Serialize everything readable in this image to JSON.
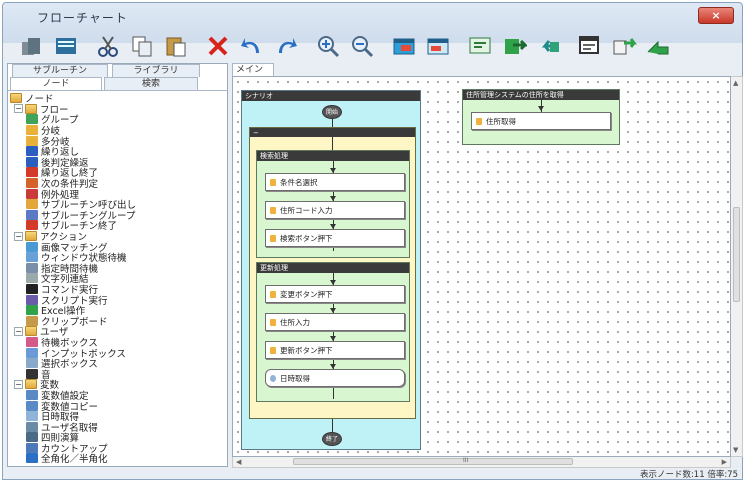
{
  "window": {
    "title": "フローチャート",
    "close_label": "×"
  },
  "toolbar": {
    "buttons": [
      "new-icon",
      "open-icon",
      "cut-icon",
      "copy-icon",
      "paste-icon",
      "delete-icon",
      "undo-icon",
      "redo-icon",
      "zoom-in-icon",
      "zoom-out-icon",
      "insert-icon",
      "insert-alt-icon",
      "edit-icon",
      "import-icon",
      "export-icon",
      "property-icon",
      "replace-icon",
      "run-icon"
    ]
  },
  "left_panel": {
    "tabs_top": [
      "サブルーチン",
      "ライブラリ"
    ],
    "tabs_bottom": [
      "ノード",
      "検索"
    ],
    "tree": [
      {
        "label": "ノード",
        "depth": 0,
        "expander": "",
        "icon": "folder"
      },
      {
        "label": "フロー",
        "depth": 1,
        "expander": "−",
        "icon": "folder"
      },
      {
        "label": "グループ",
        "depth": 2,
        "expander": "",
        "icon": "group"
      },
      {
        "label": "分岐",
        "depth": 2,
        "expander": "",
        "icon": "branch"
      },
      {
        "label": "多分岐",
        "depth": 2,
        "expander": "",
        "icon": "multi-branch"
      },
      {
        "label": "繰り返し",
        "depth": 2,
        "expander": "",
        "icon": "loop"
      },
      {
        "label": "後判定繰返",
        "depth": 2,
        "expander": "",
        "icon": "loop-post"
      },
      {
        "label": "繰り返し終了",
        "depth": 2,
        "expander": "",
        "icon": "loop-end"
      },
      {
        "label": "次の条件判定",
        "depth": 2,
        "expander": "",
        "icon": "next-condition"
      },
      {
        "label": "例外処理",
        "depth": 2,
        "expander": "",
        "icon": "exception"
      },
      {
        "label": "サブルーチン呼び出し",
        "depth": 2,
        "expander": "",
        "icon": "subroutine-call"
      },
      {
        "label": "サブルーチングループ",
        "depth": 2,
        "expander": "",
        "icon": "subroutine-group"
      },
      {
        "label": "サブルーチン終了",
        "depth": 2,
        "expander": "",
        "icon": "subroutine-end"
      },
      {
        "label": "アクション",
        "depth": 1,
        "expander": "−",
        "icon": "folder"
      },
      {
        "label": "画像マッチング",
        "depth": 2,
        "expander": "",
        "icon": "image-match"
      },
      {
        "label": "ウィンドウ状態待機",
        "depth": 2,
        "expander": "",
        "icon": "window-wait"
      },
      {
        "label": "指定時間待機",
        "depth": 2,
        "expander": "",
        "icon": "time-wait"
      },
      {
        "label": "文字列連結",
        "depth": 2,
        "expander": "",
        "icon": "string-concat"
      },
      {
        "label": "コマンド実行",
        "depth": 2,
        "expander": "",
        "icon": "command"
      },
      {
        "label": "スクリプト実行",
        "depth": 2,
        "expander": "",
        "icon": "script"
      },
      {
        "label": "Excel操作",
        "depth": 2,
        "expander": "",
        "icon": "excel"
      },
      {
        "label": "クリップボード",
        "depth": 2,
        "expander": "",
        "icon": "clipboard"
      },
      {
        "label": "ユーザ",
        "depth": 1,
        "expander": "−",
        "icon": "folder"
      },
      {
        "label": "待機ボックス",
        "depth": 2,
        "expander": "",
        "icon": "wait-box"
      },
      {
        "label": "インプットボックス",
        "depth": 2,
        "expander": "",
        "icon": "input-box"
      },
      {
        "label": "選択ボックス",
        "depth": 2,
        "expander": "",
        "icon": "select-box"
      },
      {
        "label": "音",
        "depth": 2,
        "expander": "",
        "icon": "sound"
      },
      {
        "label": "変数",
        "depth": 1,
        "expander": "−",
        "icon": "folder"
      },
      {
        "label": "変数値設定",
        "depth": 2,
        "expander": "",
        "icon": "var-set"
      },
      {
        "label": "変数値コピー",
        "depth": 2,
        "expander": "",
        "icon": "var-copy"
      },
      {
        "label": "日時取得",
        "depth": 2,
        "expander": "",
        "icon": "datetime"
      },
      {
        "label": "ユーザ名取得",
        "depth": 2,
        "expander": "",
        "icon": "username"
      },
      {
        "label": "四則演算",
        "depth": 2,
        "expander": "",
        "icon": "arithmetic"
      },
      {
        "label": "カウントアップ",
        "depth": 2,
        "expander": "",
        "icon": "count-up"
      },
      {
        "label": "全角化／半角化",
        "depth": 2,
        "expander": "",
        "icon": "width-convert"
      }
    ]
  },
  "canvas": {
    "tab_label": "メイン",
    "scenario_label": "シナリオ",
    "start_label": "開始",
    "end_label": "終了",
    "group1_label": "検索処理",
    "group1_steps": [
      "条件名選択",
      "住所コード入力",
      "検索ボタン押下"
    ],
    "group2_label": "更新処理",
    "group2_steps": [
      "変更ボタン押下",
      "住所入力",
      "更新ボタン押下",
      "日時取得"
    ],
    "side_panel_label": "住所管理システムの住所を取得",
    "side_step": "住所取得",
    "scroll_mark": "III"
  },
  "status": {
    "text": "表示ノード数:11   倍率:75"
  },
  "colors": {
    "scenario_bg": "#bff2f6",
    "group_outer_bg": "#fff6c6",
    "group_inner_bg": "#d8f6d0",
    "side_panel_bg": "#d8f6d0"
  }
}
